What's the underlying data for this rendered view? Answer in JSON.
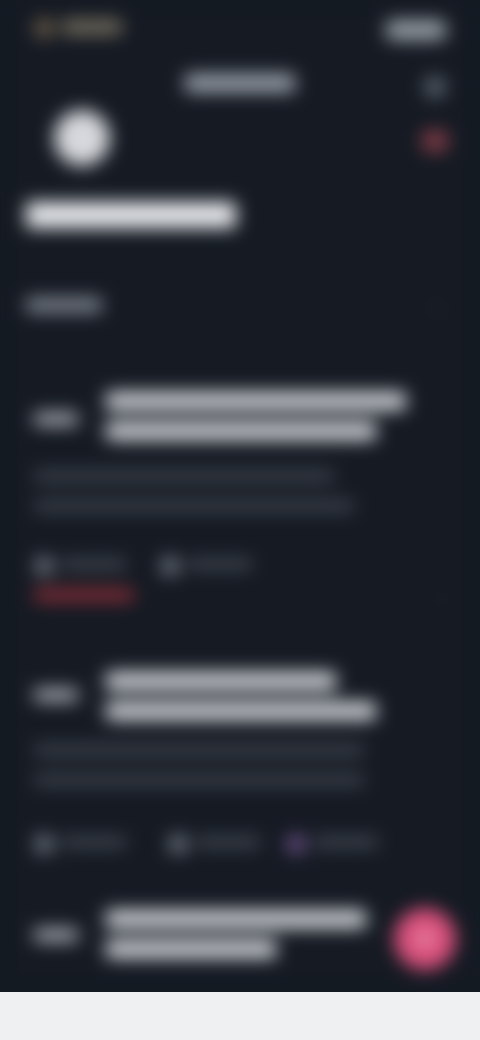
{
  "status_bar": {
    "time": ""
  },
  "header": {
    "title": ""
  },
  "profile": {
    "name": ""
  },
  "section": {
    "label": ""
  },
  "posts": [
    {
      "time": "",
      "title": "",
      "body": "",
      "meta_1": "",
      "meta_2": "",
      "tag": ""
    },
    {
      "time": "",
      "title": "",
      "body": "",
      "meta_1": "",
      "meta_2": "",
      "meta_3": ""
    },
    {
      "time": "",
      "title": ""
    }
  ],
  "fab": {
    "icon": "plus-icon",
    "symbol": "+"
  },
  "colors": {
    "background": "#151a23",
    "accent": "#d9507c",
    "tag": "#a33b46",
    "bottom_bar": "#eff0f2"
  }
}
